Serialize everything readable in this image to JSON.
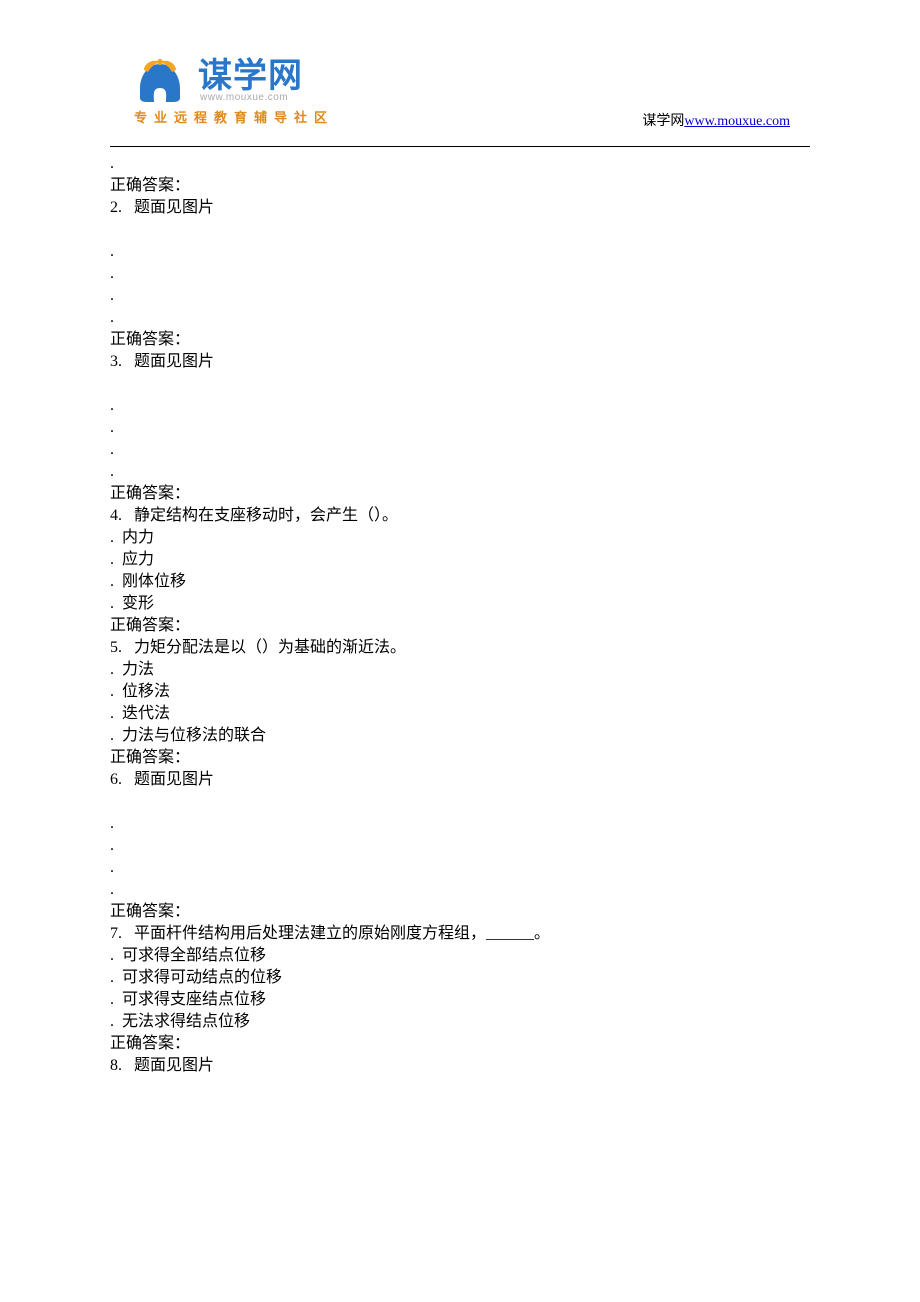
{
  "header": {
    "logo_main": "谋学网",
    "logo_url": "www.mouxue.com",
    "logo_sub": "专业远程教育辅导社区",
    "right_prefix": "谋学网",
    "right_link_text": "www.mouxue.com"
  },
  "q_fragment": {
    "dots": [
      "."
    ],
    "answer_label": "正确答案："
  },
  "q2": {
    "num_text": "2.   题面见图片",
    "dots": [
      ".",
      ".",
      ".",
      "."
    ],
    "answer_label": "正确答案："
  },
  "q3": {
    "num_text": "3.   题面见图片",
    "dots": [
      ".",
      ".",
      ".",
      "."
    ],
    "answer_label": "正确答案："
  },
  "q4": {
    "num_text": "4.   静定结构在支座移动时，会产生（）。",
    "options": [
      ".  内力",
      ".  应力",
      ".  刚体位移",
      ".  变形"
    ],
    "answer_label": "正确答案："
  },
  "q5": {
    "num_text": "5.   力矩分配法是以（）为基础的渐近法。",
    "options": [
      ".  力法",
      ".  位移法",
      ".  迭代法",
      ".  力法与位移法的联合"
    ],
    "answer_label": "正确答案："
  },
  "q6": {
    "num_text": "6.   题面见图片",
    "dots": [
      ".",
      ".",
      ".",
      "."
    ],
    "answer_label": "正确答案："
  },
  "q7": {
    "num_text": "7.   平面杆件结构用后处理法建立的原始刚度方程组，______。",
    "options": [
      ".  可求得全部结点位移",
      ".  可求得可动结点的位移",
      ".  可求得支座结点位移",
      ".  无法求得结点位移"
    ],
    "answer_label": "正确答案："
  },
  "q8": {
    "num_text": "8.   题面见图片"
  }
}
